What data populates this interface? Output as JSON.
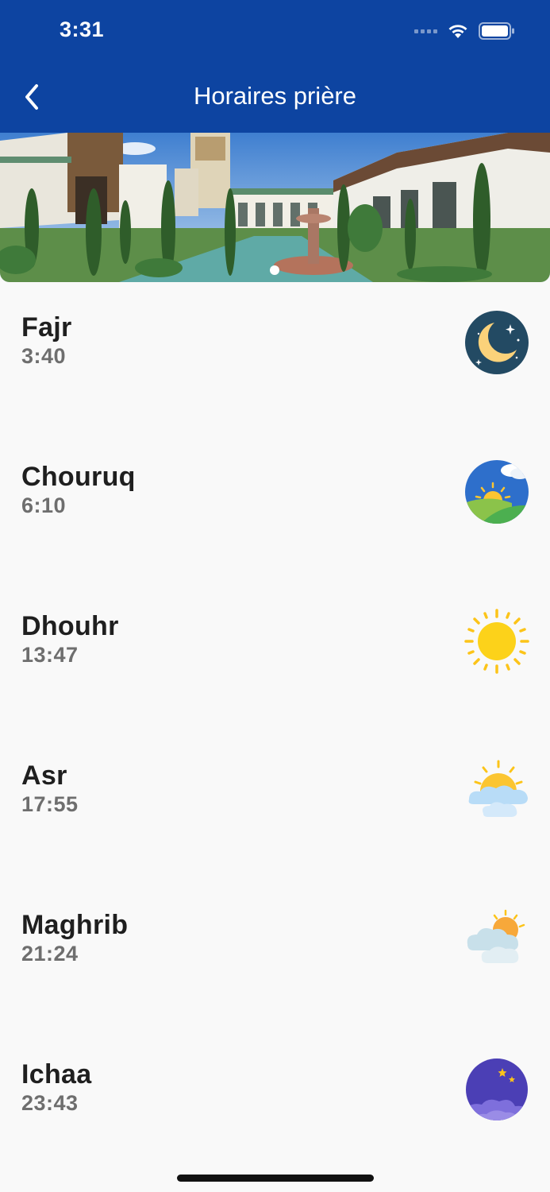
{
  "status_bar": {
    "time": "3:31"
  },
  "nav": {
    "title": "Horaires prière"
  },
  "banner": {
    "page_index": 1,
    "page_count": 1
  },
  "prayers": [
    {
      "name": "Fajr",
      "time": "3:40",
      "icon": "crescent-moon-night-icon"
    },
    {
      "name": "Chouruq",
      "time": "6:10",
      "icon": "sunrise-icon"
    },
    {
      "name": "Dhouhr",
      "time": "13:47",
      "icon": "sun-icon"
    },
    {
      "name": "Asr",
      "time": "17:55",
      "icon": "sun-behind-cloud-icon"
    },
    {
      "name": "Maghrib",
      "time": "21:24",
      "icon": "sunset-cloud-icon"
    },
    {
      "name": "Ichaa",
      "time": "23:43",
      "icon": "moon-stars-icon"
    }
  ],
  "colors": {
    "header": "#0d44a1",
    "background": "#f9f9f9",
    "name": "#1f1f1f",
    "time": "#6e6e6e"
  }
}
